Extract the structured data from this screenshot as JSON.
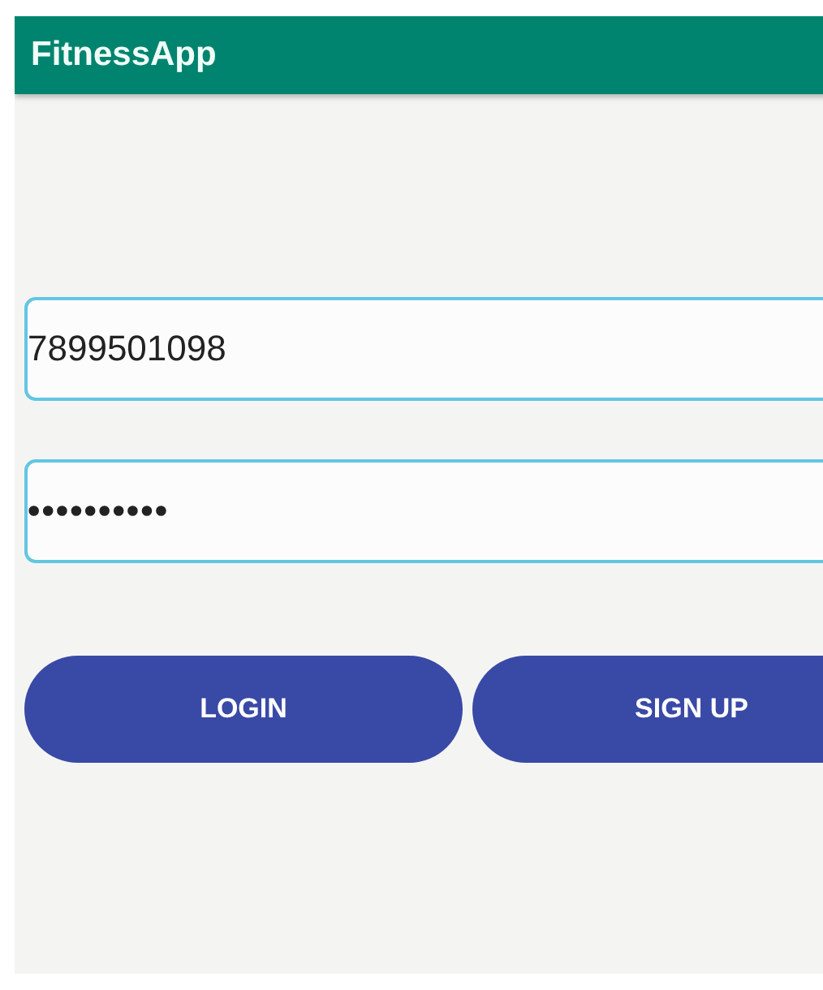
{
  "app_bar": {
    "title": "FitnessApp"
  },
  "phone_field": {
    "value": "7899501098"
  },
  "password_field": {
    "value": "••••••••••"
  },
  "buttons": [
    "LOGIN",
    "SIGN UP"
  ]
}
